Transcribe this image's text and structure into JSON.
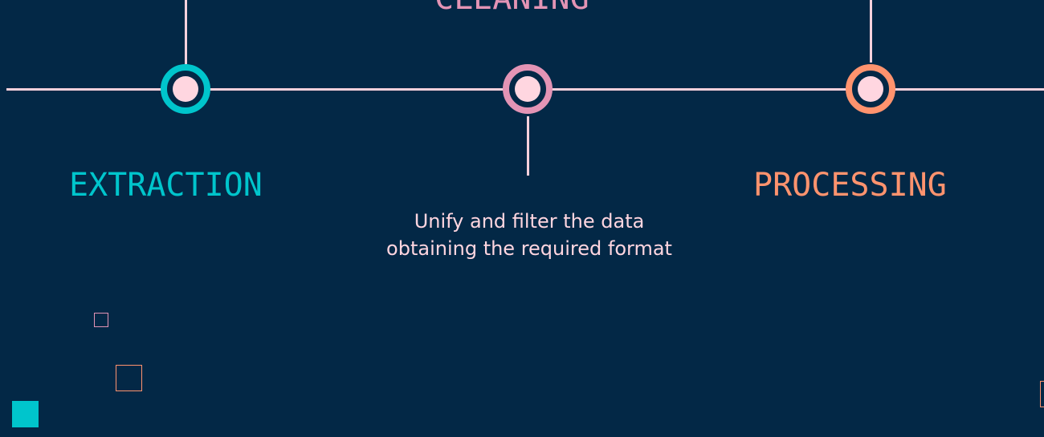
{
  "diagram": {
    "stages": [
      {
        "id": "extraction",
        "title": "EXTRACTION",
        "color": "#00c5cc"
      },
      {
        "id": "cleaning",
        "title": "CLEANING",
        "color": "#e394b5",
        "description": "Unify and filter the data obtaining the required format"
      },
      {
        "id": "processing",
        "title": "PROCESSING",
        "color": "#ff936e"
      }
    ]
  },
  "colors": {
    "background": "#032846",
    "line": "#f8d1dc",
    "dot": "#ffd6e0",
    "teal": "#00c5cc",
    "pink": "#e394b5",
    "orange": "#ff936e"
  }
}
